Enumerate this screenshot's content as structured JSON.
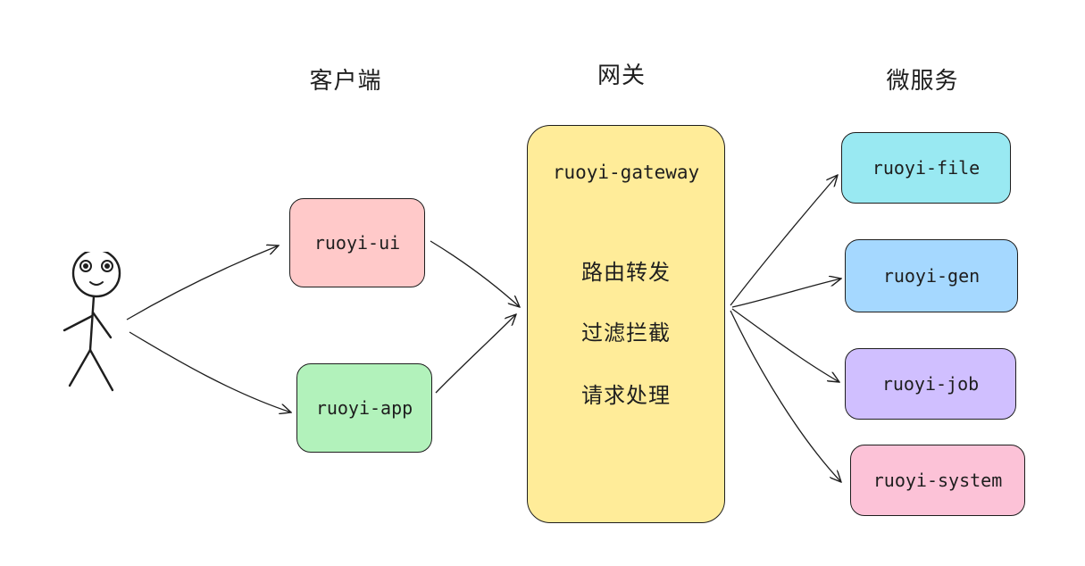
{
  "headers": {
    "client": "客户端",
    "gateway": "网关",
    "services": "微服务"
  },
  "clients": [
    {
      "id": "ui",
      "label": "ruoyi-ui",
      "color": "#ffc9c9"
    },
    {
      "id": "app",
      "label": "ruoyi-app",
      "color": "#b2f2bb"
    }
  ],
  "gateway": {
    "title": "ruoyi-gateway",
    "functions": [
      "路由转发",
      "过滤拦截",
      "请求处理"
    ],
    "color": "#ffec99"
  },
  "services": [
    {
      "id": "file",
      "label": "ruoyi-file",
      "color": "#99e9f2"
    },
    {
      "id": "gen",
      "label": "ruoyi-gen",
      "color": "#a5d8ff"
    },
    {
      "id": "job",
      "label": "ruoyi-job",
      "color": "#d0bfff"
    },
    {
      "id": "system",
      "label": "ruoyi-system",
      "color": "#fcc2d7"
    }
  ],
  "icons": {
    "user": "stick-figure-user-icon"
  }
}
